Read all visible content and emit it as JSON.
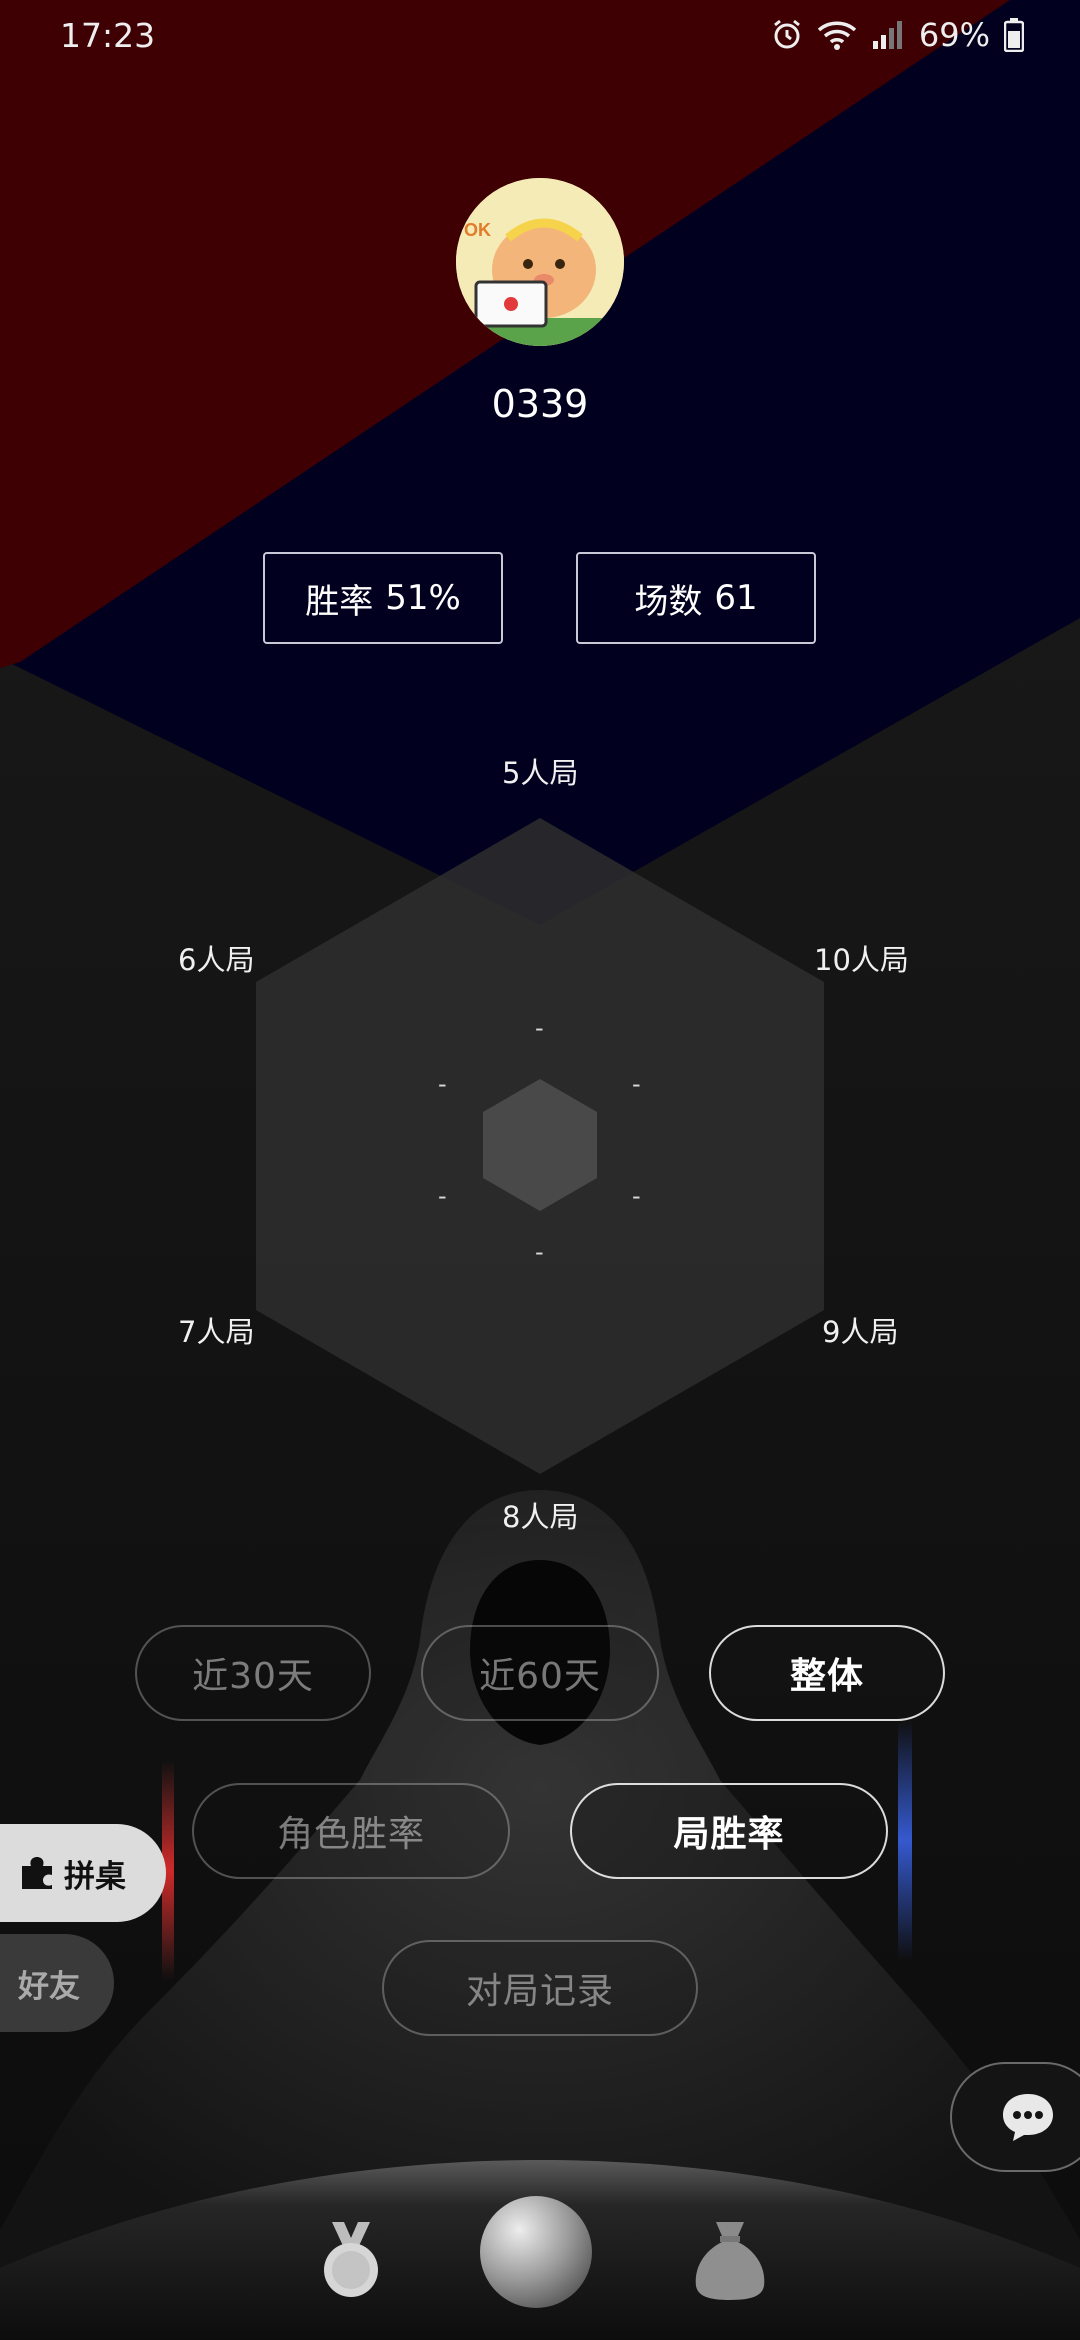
{
  "status_bar": {
    "time": "17:23",
    "battery": "69%",
    "icons": [
      "alarm-icon",
      "wifi-icon",
      "signal-icon",
      "battery-icon"
    ]
  },
  "profile": {
    "username": "0339",
    "avatar_icon": "cat-avatar",
    "avatar_text": "OK"
  },
  "stats": {
    "winrate_label": "胜率",
    "winrate_value": "51%",
    "games_label": "场数",
    "games_value": "61"
  },
  "radar": {
    "labels": {
      "top": "5人局",
      "upper_left": "6人局",
      "upper_right": "10人局",
      "lower_left": "7人局",
      "lower_right": "9人局",
      "bottom": "8人局"
    },
    "values": {
      "top": "-",
      "upper_left": "-",
      "upper_right": "-",
      "lower_left": "-",
      "lower_right": "-",
      "bottom": "-"
    }
  },
  "filters": {
    "period": [
      "近30天",
      "近60天",
      "整体"
    ],
    "period_selected": "整体",
    "metric": [
      "角色胜率",
      "局胜率"
    ],
    "metric_selected": "局胜率",
    "history": "对局记录"
  },
  "side_tabs": {
    "pinzhuo": "拼桌",
    "friends": "好友"
  },
  "bottom_nav": [
    "medal-icon",
    "home-orb-icon",
    "money-bag-icon"
  ],
  "colors": {
    "red_region": "#3e0003",
    "navy_region": "#01001f",
    "radar_fill": "#2e2e2e"
  }
}
